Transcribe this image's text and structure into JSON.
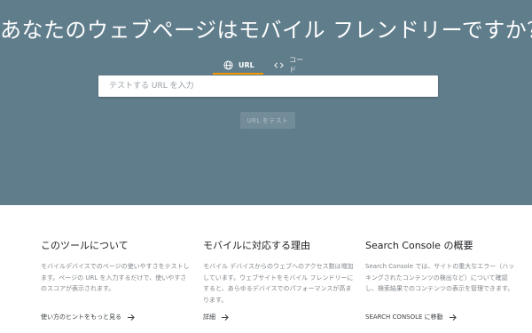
{
  "hero": {
    "title": "あなたのウェブページはモバイル フレンドリーですか？",
    "background": "#607d8b"
  },
  "tabs": [
    {
      "label": "URL",
      "icon": "globe-icon",
      "active": true
    },
    {
      "label": "コード",
      "icon": "code-icon",
      "active": false
    }
  ],
  "url_input": {
    "placeholder": "テストする URL を入力",
    "value": ""
  },
  "test_button": {
    "label": "URL をテスト"
  },
  "info_columns": [
    {
      "title": "このツールについて",
      "body": "モバイルデバイスでのページの使いやすさをテストします。ページの URL を入力するだけで、使いやすさのスコアが表示されます。",
      "link": "使い方のヒントをもっと見る",
      "link_icon": "arrow-right-icon"
    },
    {
      "title": "モバイルに対応する理由",
      "body": "モバイル デバイスからのウェブへのアクセス数は増加しています。ウェブサイトをモバイル フレンドリーにすると、あらゆるデバイスでのパフォーマンスが高まります。",
      "link": "詳細",
      "link_icon": "arrow-right-icon"
    },
    {
      "title": "Search Console の概要",
      "body": "Search Console では、サイトの重大なエラー（ハッキングされたコンテンツの検出など）について確認し、検索結果でのコンテンツの表示を管理できます。",
      "link": "SEARCH CONSOLE に移動",
      "link_icon": "arrow-right-icon"
    }
  ],
  "colors": {
    "accent": "#f29900",
    "hero": "#607d8b"
  }
}
